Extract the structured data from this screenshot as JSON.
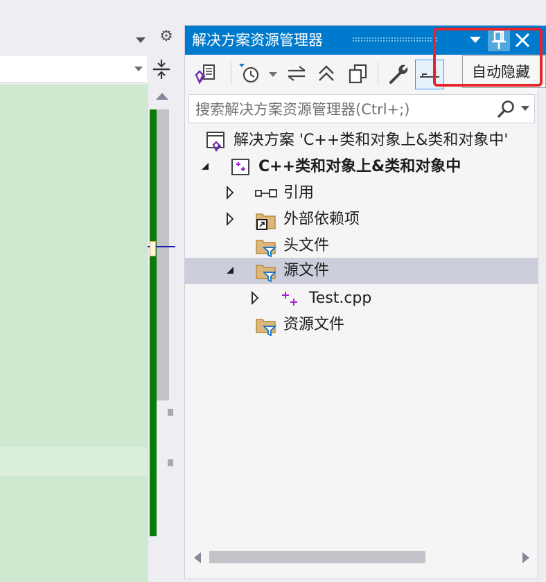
{
  "panel": {
    "title": "解决方案资源管理器",
    "auto_hide_tooltip": "自动隐藏"
  },
  "search": {
    "placeholder": "搜索解决方案资源管理器(Ctrl+;)"
  },
  "tree": {
    "solution_label": "解决方案 'C++类和对象上&类和对象中'",
    "project_label": "C++类和对象上&类和对象中",
    "items": [
      {
        "label": "引用"
      },
      {
        "label": "外部依赖项"
      },
      {
        "label": "头文件"
      },
      {
        "label": "源文件"
      },
      {
        "label": "Test.cpp"
      },
      {
        "label": "资源文件"
      }
    ]
  },
  "icons": {
    "toolbar": [
      "vs-switch-view-icon",
      "pending-changes-icon",
      "sync-icon",
      "collapse-all-icon",
      "copy-icon",
      "properties-wrench-icon",
      "preview-icon"
    ],
    "title": [
      "dropdown-icon",
      "pin-icon",
      "close-icon"
    ]
  },
  "colors": {
    "accent": "#007acc",
    "highlight": "#e8242b",
    "folder": "#dcb67a",
    "filter": "#1f7ac4",
    "cpp": "#a21fd3",
    "selected_row": "#cccedb",
    "editor_bg": "#cfe8d0",
    "change_bar": "#0a7a0a"
  }
}
